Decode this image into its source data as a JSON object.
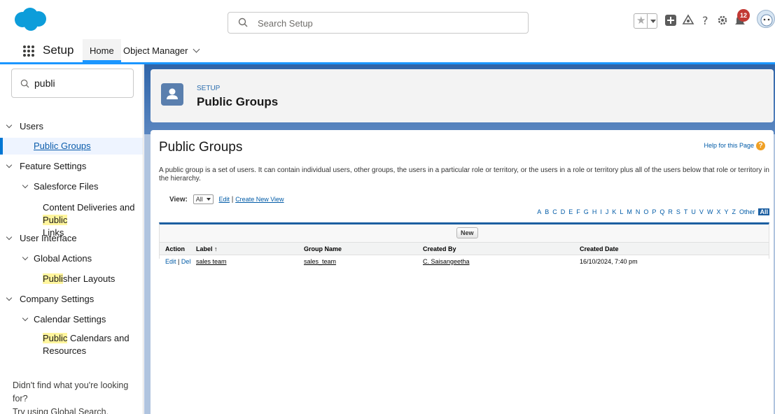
{
  "header": {
    "search_placeholder": "Search Setup",
    "notification_count": "12"
  },
  "context_bar": {
    "app_name": "Setup",
    "tabs": [
      {
        "label": "Home"
      },
      {
        "label": "Object Manager"
      }
    ]
  },
  "sidebar": {
    "quick_find_value": "publi",
    "tree": {
      "users": "Users",
      "public_groups": "Public Groups",
      "feature_settings": "Feature Settings",
      "salesforce_files": "Salesforce Files",
      "content_deliveries_prefix": "Content Deliveries and ",
      "content_deliveries_match": "Public",
      "content_deliveries_suffix": "Links",
      "user_interface": "User Interface",
      "global_actions": "Global Actions",
      "publisher_match": "Publi",
      "publisher_suffix": "sher Layouts",
      "company_settings": "Company Settings",
      "calendar_settings": "Calendar Settings",
      "public_calendars_match": "Public",
      "public_calendars_suffix": " Calendars and",
      "public_calendars_line2": "Resources"
    },
    "footer_line1": "Didn't find what you're looking for?",
    "footer_line2": "Try using Global Search."
  },
  "page_header": {
    "breadcrumb": "SETUP",
    "title": "Public Groups"
  },
  "content": {
    "title": "Public Groups",
    "help_link": "Help for this Page",
    "description": "A public group is a set of users. It can contain individual users, other groups, the users in a particular role or territory, or the users in a role or territory plus all of the users below that role or territory in the hierarchy.",
    "view_label": "View:",
    "view_value": "All",
    "edit_link": "Edit",
    "create_view_link": "Create New View",
    "alphabet": [
      "A",
      "B",
      "C",
      "D",
      "E",
      "F",
      "G",
      "H",
      "I",
      "J",
      "K",
      "L",
      "M",
      "N",
      "O",
      "P",
      "Q",
      "R",
      "S",
      "T",
      "U",
      "V",
      "W",
      "X",
      "Y",
      "Z",
      "Other"
    ],
    "alphabet_all": "All",
    "new_button": "New",
    "columns": [
      "Action",
      "Label ↑",
      "Group Name",
      "Created By",
      "Created Date"
    ],
    "rows": [
      {
        "edit": "Edit",
        "del": "Del",
        "label": "sales team",
        "group_name": "sales_team",
        "created_by": "C. Saisangeetha",
        "created_date": "16/10/2024, 7:40 pm"
      }
    ]
  },
  "colors": {
    "brand_blue": "#0176d3",
    "band_blue": "#2f64a8",
    "link_blue": "#015ba7",
    "highlight": "#fff59d"
  }
}
